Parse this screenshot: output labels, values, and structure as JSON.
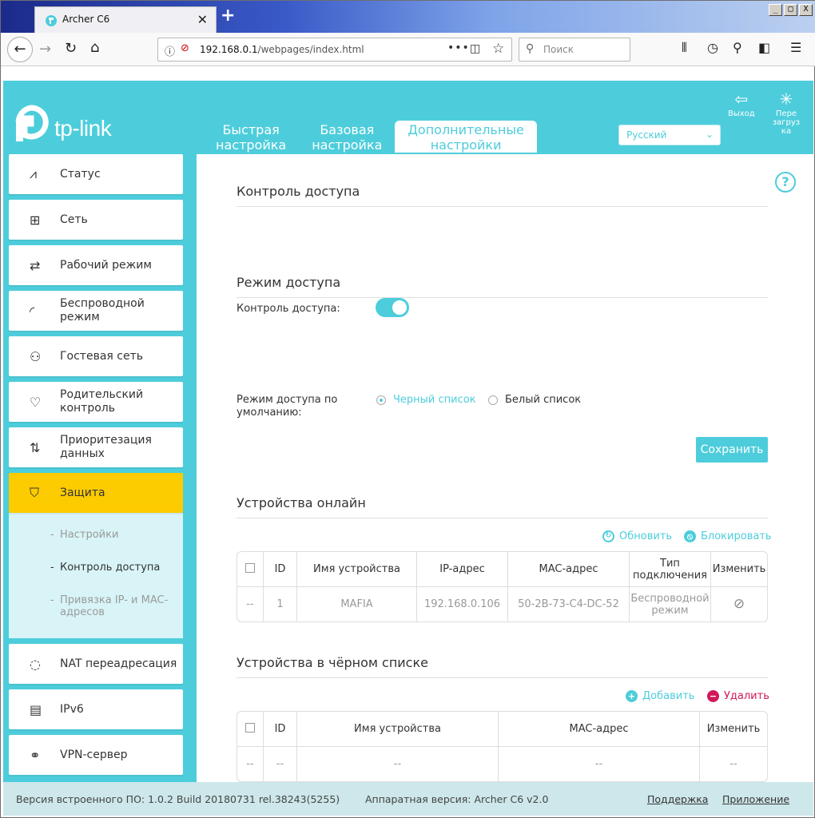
{
  "browser": {
    "tab_title": "Archer C6",
    "url_host": "192.168.0.1",
    "url_path": "/webpages/index.html",
    "search_placeholder": "Поиск",
    "win_min": "_",
    "win_max": "□",
    "win_close": "X",
    "new_tab": "+"
  },
  "header": {
    "brand": "tp-link",
    "nav": [
      {
        "label": "Быстрая\nнастройка"
      },
      {
        "label": "Базовая\nнастройка"
      },
      {
        "label": "Дополнительные\nнастройки"
      }
    ],
    "language": "Русский",
    "logout_label": "Выход",
    "reboot_label": "Пере\nзагруз\nка"
  },
  "sidebar": {
    "items": [
      {
        "label": "Статус"
      },
      {
        "label": "Сеть"
      },
      {
        "label": "Рабочий режим"
      },
      {
        "label": "Беспроводной\nрежим"
      },
      {
        "label": "Гостевая сеть"
      },
      {
        "label": "Родительский\nконтроль"
      },
      {
        "label": "Приоритезация\nданных"
      },
      {
        "label": "Защита"
      },
      {
        "label": "NAT переадресация"
      },
      {
        "label": "IPv6"
      },
      {
        "label": "VPN-сервер"
      }
    ],
    "sub": [
      {
        "label": "Настройки"
      },
      {
        "label": "Контроль доступа"
      },
      {
        "label": "Привязка IP- и MAC-\nадресов"
      }
    ]
  },
  "content": {
    "access_control": {
      "title": "Контроль доступа",
      "label": "Контроль доступа:",
      "enabled": true
    },
    "access_mode": {
      "title": "Режим доступа",
      "label": "Режим доступа по\nумолчанию:",
      "options": [
        "Черный список",
        "Белый список"
      ],
      "selected": "Черный список",
      "save": "Сохранить"
    },
    "online": {
      "title": "Устройства онлайн",
      "refresh": "Обновить",
      "block": "Блокировать",
      "columns": [
        "ID",
        "Имя устройства",
        "IP-адрес",
        "MAC-адрес",
        "Тип\nподключения",
        "Изменить"
      ],
      "rows": [
        {
          "sel": "--",
          "id": "1",
          "name": "MAFIA",
          "ip": "192.168.0.106",
          "mac": "50-2B-73-C4-DC-52",
          "type": "Беспроводной\nрежим"
        }
      ]
    },
    "blacklist": {
      "title": "Устройства в чёрном списке",
      "add": "Добавить",
      "delete": "Удалить",
      "columns": [
        "ID",
        "Имя устройства",
        "MAC-адрес",
        "Изменить"
      ],
      "rows": [
        {
          "sel": "--",
          "id": "--",
          "name": "--",
          "mac": "--",
          "edit": "--"
        }
      ]
    }
  },
  "footer": {
    "firmware": "Версия встроенного ПО: 1.0.2 Build 20180731 rel.38243(5255)",
    "hardware": "Аппаратная версия: Archer C6 v2.0",
    "support": "Поддержка",
    "app": "Приложение"
  },
  "colors": {
    "accent": "#4dcddb",
    "active_item": "#fccb00",
    "delete": "#d0195a"
  }
}
